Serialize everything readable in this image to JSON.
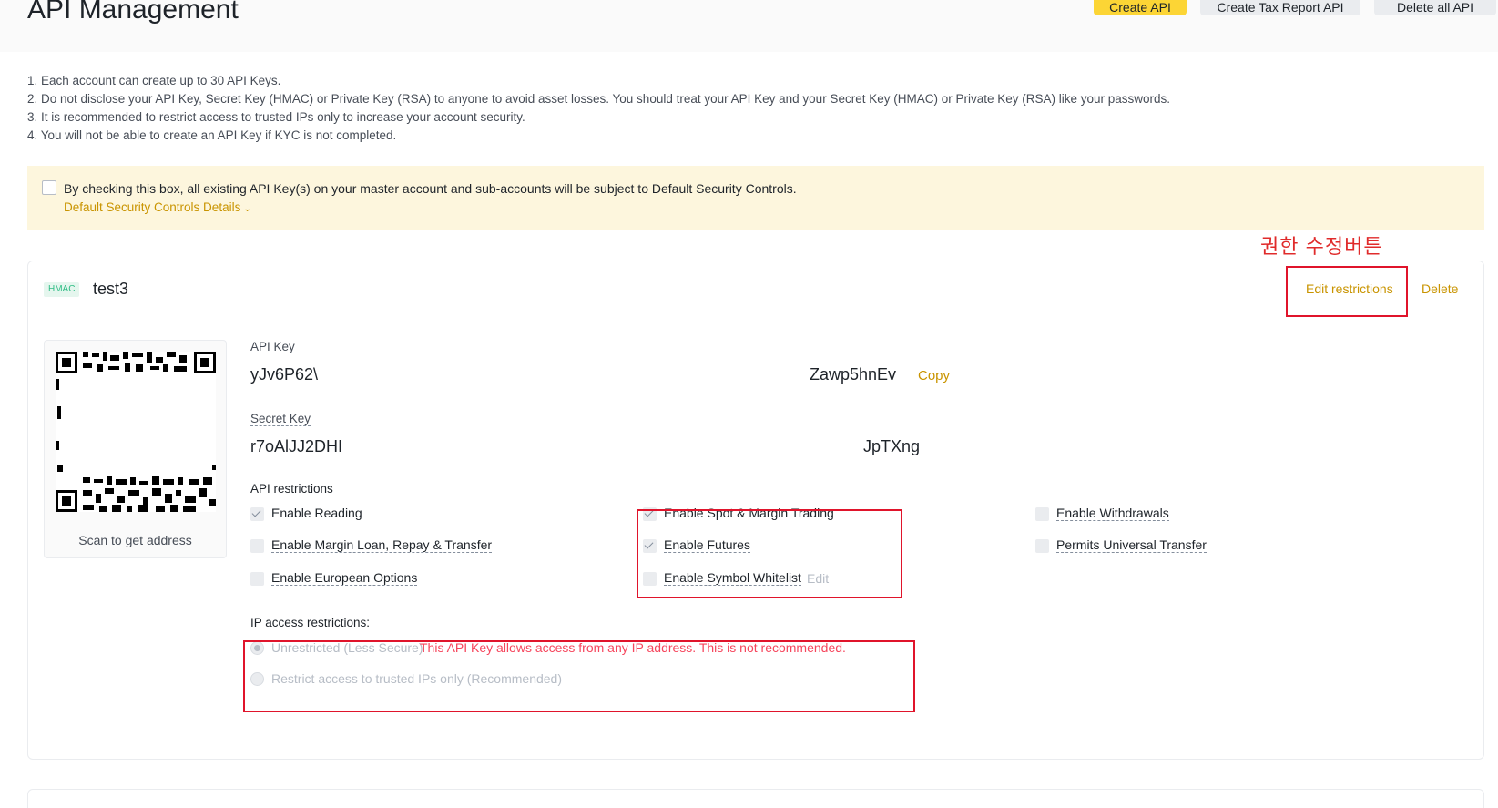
{
  "page": {
    "title": "API Management",
    "buttons": {
      "create_api": "Create API",
      "create_tax_report_api": "Create Tax Report API",
      "delete_all_api": "Delete all API"
    }
  },
  "notes": [
    "1. Each account can create up to 30 API Keys.",
    "2. Do not disclose your API Key, Secret Key (HMAC) or Private Key (RSA) to anyone to avoid asset losses. You should treat your API Key and your Secret Key (HMAC) or Private Key (RSA) like your passwords.",
    "3. It is recommended to restrict access to trusted IPs only to increase your account security.",
    "4. You will not be able to create an API Key if KYC is not completed."
  ],
  "security_notice": {
    "checkbox_checked": false,
    "text": "By checking this box, all existing API Key(s) on your master account and sub-accounts will be subject to Default Security Controls.",
    "details_link": "Default Security Controls Details"
  },
  "annotation": {
    "label": "권한 수정버튼"
  },
  "api_card": {
    "badge": "HMAC",
    "name": "test3",
    "edit_restrictions": "Edit restrictions",
    "delete": "Delete",
    "qr_caption": "Scan to get address",
    "api_key_label": "API Key",
    "api_key_start": "yJv6P62\\",
    "api_key_end": "Zawp5hnEv",
    "copy": "Copy",
    "secret_key_label": "Secret Key",
    "secret_key_start": "r7oAlJJ2DHI",
    "secret_key_end": "JpTXng",
    "restrictions_label": "API restrictions",
    "permissions": {
      "enable_reading": {
        "label": "Enable Reading",
        "checked": true
      },
      "enable_spot_margin": {
        "label": "Enable Spot & Margin Trading",
        "checked": true
      },
      "enable_withdrawals": {
        "label": "Enable Withdrawals",
        "checked": false
      },
      "enable_margin_loan": {
        "label": "Enable Margin Loan, Repay & Transfer",
        "checked": false
      },
      "enable_futures": {
        "label": "Enable Futures",
        "checked": true
      },
      "universal_transfer": {
        "label": "Permits Universal Transfer",
        "checked": false
      },
      "enable_european_options": {
        "label": "Enable European Options",
        "checked": false
      },
      "enable_symbol_whitelist": {
        "label": "Enable Symbol Whitelist",
        "checked": false
      }
    },
    "symbol_whitelist_edit": "Edit",
    "ip_label": "IP access restrictions:",
    "ip_unrestricted": "Unrestricted (Less Secure)",
    "ip_warning": "This API Key allows access from any IP address. This is not recommended.",
    "ip_restricted": "Restrict access to trusted IPs only (Recommended)",
    "ip_selected": "unrestricted"
  },
  "colors": {
    "brand_yellow": "#fcd535",
    "link_gold": "#c99400",
    "warning_red": "#f6465d",
    "annotation_red": "#e0142b",
    "notice_bg": "#fdf6dd"
  }
}
